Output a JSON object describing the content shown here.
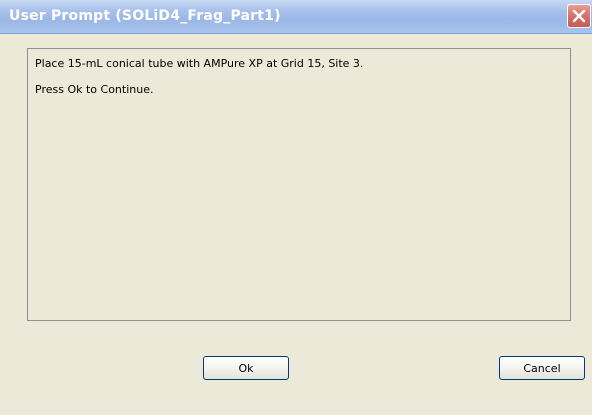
{
  "window": {
    "title": "User Prompt (SOLiD4_Frag_Part1)"
  },
  "message": {
    "line1": "Place 15-mL conical tube with AMPure XP at Grid 15, Site 3.",
    "line2": "Press Ok to Continue."
  },
  "buttons": {
    "ok_label": "Ok",
    "cancel_label": "Cancel"
  },
  "icons": {
    "close": "close-icon"
  },
  "colors": {
    "titlebar": "#a6c0ea",
    "title_text": "#ffffff",
    "close_button": "#d4706a",
    "window_bg": "#ece9d8",
    "panel_border": "#8e8f8f",
    "button_border": "#003c74"
  }
}
